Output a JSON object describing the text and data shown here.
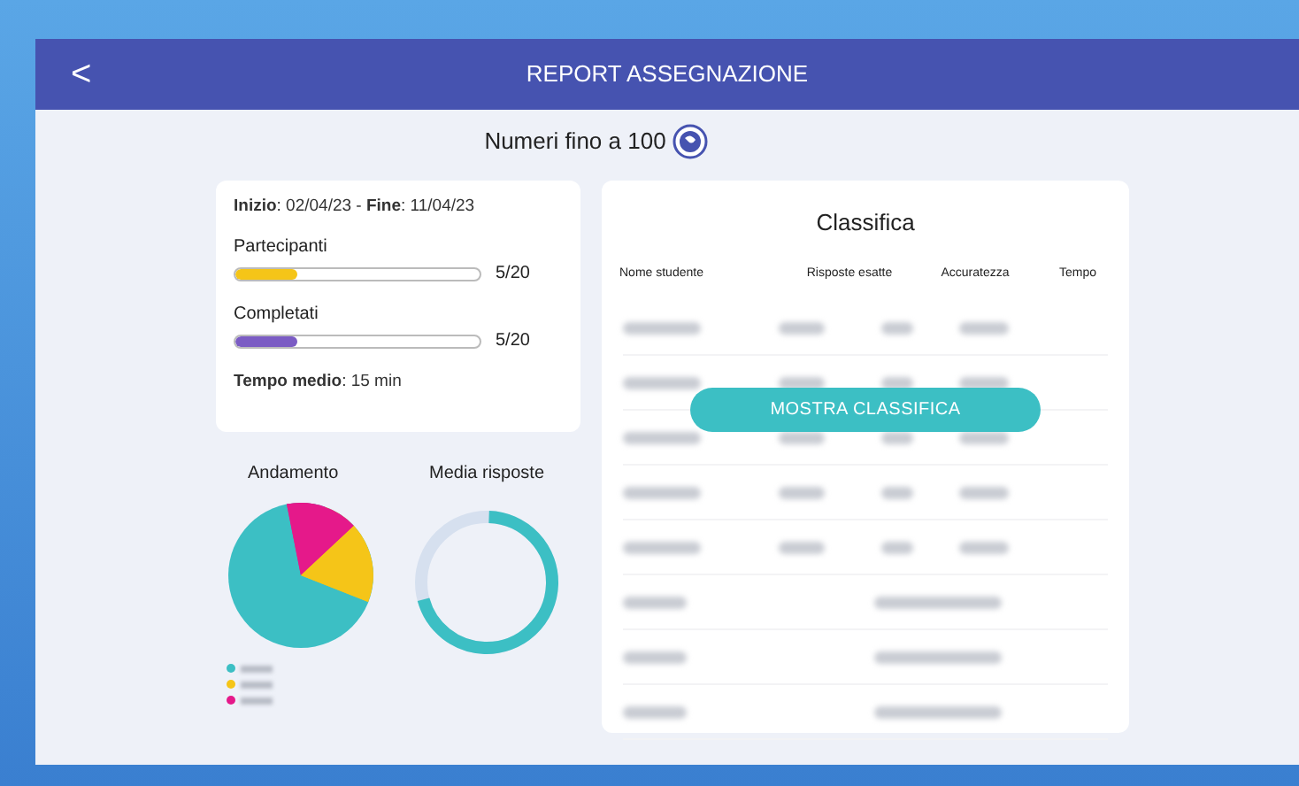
{
  "header": {
    "back": "<",
    "title": "REPORT ASSEGNAZIONE"
  },
  "subtitle": "Numeri fino a 100",
  "summary": {
    "dates": "**Inizio**: 02/04/23 - **Fine**: 11/04/23",
    "bars": [
      {
        "label": "Partecipanti",
        "level": 0.25,
        "reading": "5/20",
        "color": "#f5c518"
      },
      {
        "label": "Completati",
        "level": 0.25,
        "reading": "5/20",
        "color": "#7b5cc4"
      }
    ],
    "time": "**Tempo medio**: 15 min"
  },
  "charts": {
    "pie_title": "Andamento",
    "donut_title": "Media risposte",
    "legend": [
      {
        "color": "#3cbfc4"
      },
      {
        "color": "#f5c518"
      },
      {
        "color": "#e5198a"
      }
    ]
  },
  "ranking": {
    "title": "Classifica",
    "columns": [
      "Nome studente",
      "Risposte esatte",
      "Accuratezza",
      "Tempo"
    ],
    "rows": [
      {
        "kind": "scored"
      },
      {
        "kind": "scored"
      },
      {
        "kind": "scored"
      },
      {
        "kind": "scored"
      },
      {
        "kind": "scored"
      },
      {
        "kind": "pending"
      },
      {
        "kind": "pending"
      },
      {
        "kind": "pending"
      }
    ],
    "button": "MOSTRA CLASSIFICA"
  }
}
